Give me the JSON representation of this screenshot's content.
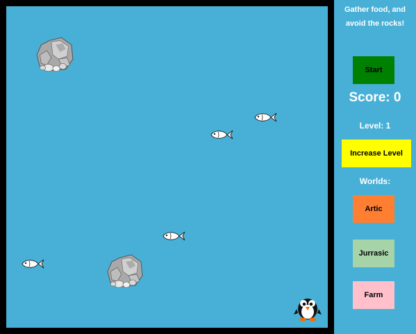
{
  "sidebar": {
    "instructions_line1": "Gather food, and",
    "instructions_line2": "avoid the rocks!",
    "start_label": "Start",
    "score_label": "Score: 0",
    "level_label": "Level: 1",
    "increase_level_label": "Increase Level",
    "worlds_label": "Worlds:",
    "worlds": [
      {
        "label": "Artic",
        "color": "#ff7f32"
      },
      {
        "label": "Jurrasic",
        "color": "#a6d4a8"
      },
      {
        "label": "Farm",
        "color": "#ffc0cb"
      }
    ],
    "start_color": "#008000",
    "increase_level_color": "#ffff00"
  },
  "game": {
    "water_color": "#48b0d6",
    "border_color": "#000000",
    "sprites": [
      "rock-icon",
      "rock-icon",
      "fish-icon",
      "fish-icon",
      "fish-icon",
      "fish-icon",
      "penguin-icon"
    ]
  }
}
